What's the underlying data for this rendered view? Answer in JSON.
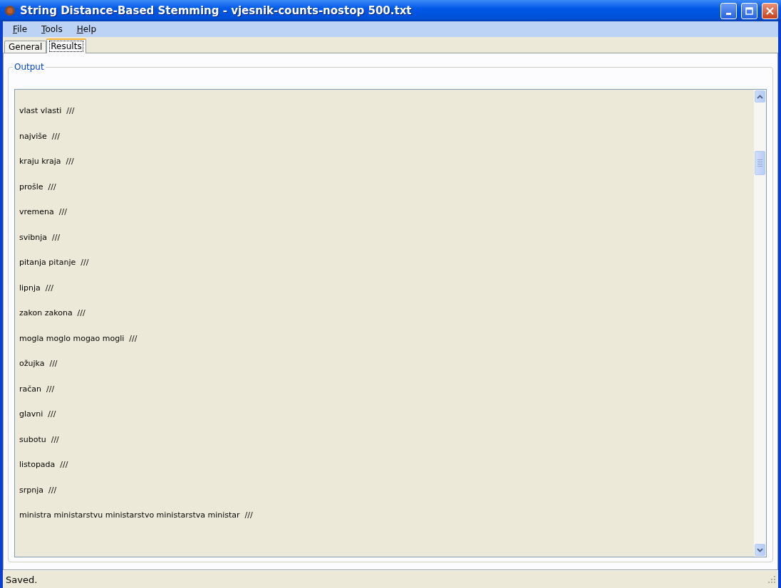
{
  "window": {
    "title": "String Distance-Based Stemming - vjesnik-counts-nostop 500.txt"
  },
  "menu": [
    {
      "label": "File"
    },
    {
      "label": "Tools"
    },
    {
      "label": "Help"
    }
  ],
  "tabs": [
    {
      "label": "General",
      "selected": false
    },
    {
      "label": "Results",
      "selected": true
    }
  ],
  "output": {
    "legend": "Output",
    "lines": [
      "vlast vlasti  ///",
      "najviše  ///",
      "kraju kraja  ///",
      "prošle  ///",
      "vremena  ///",
      "svibnja  ///",
      "pitanja pitanje  ///",
      "lipnja  ///",
      "zakon zakona  ///",
      "mogla moglo mogao mogli  ///",
      "ožujka  ///",
      "račan  ///",
      "glavni  ///",
      "subotu  ///",
      "listopada  ///",
      "srpnja  ///",
      "ministra ministarstvu ministarstvo ministarstva ministar  ///"
    ]
  },
  "status_bar": {
    "text": "Saved."
  }
}
